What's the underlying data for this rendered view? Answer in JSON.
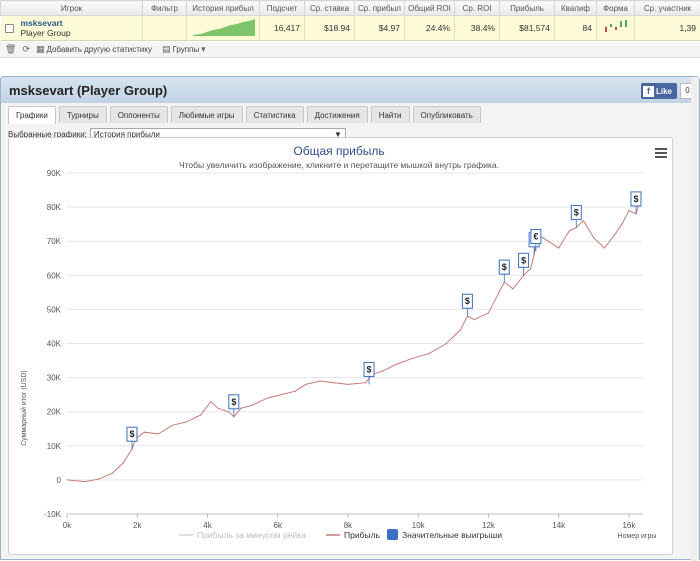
{
  "table": {
    "headers": [
      "Игрок",
      "Фильтр",
      "История прибыл",
      "Подсчет",
      "Ср. ставка",
      "Ср. прибыл",
      "Общий ROI",
      "Ср. ROI",
      "Прибыль",
      "Квалиф",
      "Форма",
      "Ср. участник"
    ],
    "row": {
      "player_name": "msksevart",
      "player_group": "Player Group",
      "filter": "",
      "count": "16,417",
      "avg_stake": "$18.94",
      "avg_profit": "$4.97",
      "total_roi": "24.4%",
      "avg_roi": "38.4%",
      "profit": "$81,574",
      "qualify": "84",
      "avg_entrants": "1,39"
    }
  },
  "toolbar": {
    "add_stats": "Добавить другую статистику",
    "groups": "Группы"
  },
  "panel": {
    "title": "msksevart (Player Group)",
    "like_label": "Like",
    "like_count": "0",
    "tabs": [
      "Графики",
      "Турниры",
      "Оппоненты",
      "Любимые игры",
      "Статистика",
      "Достижения",
      "Найти",
      "Опубликовать"
    ],
    "selected_charts_label": "Выбранные графики:",
    "selected_chart": "История прибыли"
  },
  "chart_data": {
    "type": "line",
    "title": "Общая прибыль",
    "subtitle": "Чтобы увеличить изображение, кликните и перетащите мышкой внутрь графика.",
    "xlabel": "Номер игры",
    "ylabel": "Суммарный итог (USD)",
    "xlim": [
      0,
      16400
    ],
    "ylim": [
      -10000,
      90000
    ],
    "x_ticks": [
      "0k",
      "2k",
      "4k",
      "6k",
      "8k",
      "10k",
      "12k",
      "14k",
      "16k"
    ],
    "y_ticks": [
      "-10K",
      "0",
      "10K",
      "20K",
      "30K",
      "40K",
      "50K",
      "60K",
      "70K",
      "80K",
      "90K"
    ],
    "legend": [
      "Прибыль за минусом рейка",
      "Прибыль",
      "Значительные выигрыши"
    ],
    "legend_position": "bottom",
    "colors": {
      "profit": "#c87a7a",
      "rake_line": "#dddddd",
      "big_win": "#3a6fc1"
    },
    "series": [
      {
        "name": "Прибыль",
        "x": [
          0,
          500,
          900,
          1300,
          1600,
          1850,
          1950,
          2200,
          2600,
          3000,
          3400,
          3800,
          4100,
          4300,
          4600,
          4750,
          4950,
          5300,
          5700,
          6100,
          6500,
          6800,
          7200,
          7600,
          8000,
          8500,
          8700,
          9000,
          9400,
          9800,
          10300,
          10800,
          11200,
          11400,
          11600,
          12000,
          12300,
          12450,
          12700,
          13000,
          13200,
          13300,
          13400,
          13700,
          14000,
          14300,
          14500,
          14700,
          15000,
          15300,
          15600,
          15800,
          16000,
          16200,
          16300
        ],
        "values": [
          0,
          -500,
          200,
          2000,
          5000,
          9000,
          12000,
          14000,
          13500,
          16000,
          17000,
          19000,
          23000,
          21000,
          20000,
          18500,
          21000,
          22000,
          24000,
          25000,
          26000,
          28000,
          29000,
          28500,
          28000,
          28500,
          31000,
          32000,
          34000,
          35500,
          37000,
          40000,
          44000,
          48000,
          47000,
          49000,
          55000,
          58000,
          56000,
          60000,
          62000,
          66000,
          72000,
          70000,
          68000,
          73000,
          74000,
          76000,
          71000,
          68000,
          72000,
          75000,
          79000,
          78000,
          81500
        ]
      }
    ],
    "big_wins": [
      {
        "x": 1850,
        "y": 9000,
        "label": "$"
      },
      {
        "x": 4750,
        "y": 18500,
        "label": "$"
      },
      {
        "x": 8600,
        "y": 28000,
        "label": "$"
      },
      {
        "x": 11400,
        "y": 48000,
        "label": "$"
      },
      {
        "x": 12450,
        "y": 58000,
        "label": "$"
      },
      {
        "x": 13000,
        "y": 60000,
        "label": "$"
      },
      {
        "x": 13300,
        "y": 66000,
        "label": "$"
      },
      {
        "x": 13350,
        "y": 67000,
        "label": "€"
      },
      {
        "x": 14500,
        "y": 74000,
        "label": "$"
      },
      {
        "x": 16200,
        "y": 78000,
        "label": "$"
      }
    ]
  }
}
